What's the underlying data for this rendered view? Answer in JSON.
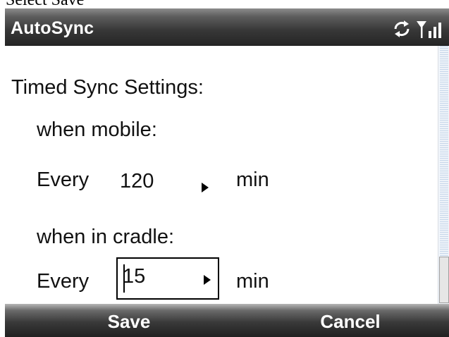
{
  "caption": "Select Save",
  "titlebar": {
    "title": "AutoSync",
    "status_icons": [
      "sync-icon",
      "signal-strength-icon"
    ]
  },
  "content": {
    "heading": "Timed Sync Settings:",
    "mobile": {
      "label": "when mobile:",
      "prefix": "Every",
      "value": "120",
      "unit": "min"
    },
    "cradle": {
      "label": "when in cradle:",
      "prefix": "Every",
      "value": "15",
      "unit": "min"
    }
  },
  "softkeys": {
    "left": "Save",
    "right": "Cancel"
  }
}
